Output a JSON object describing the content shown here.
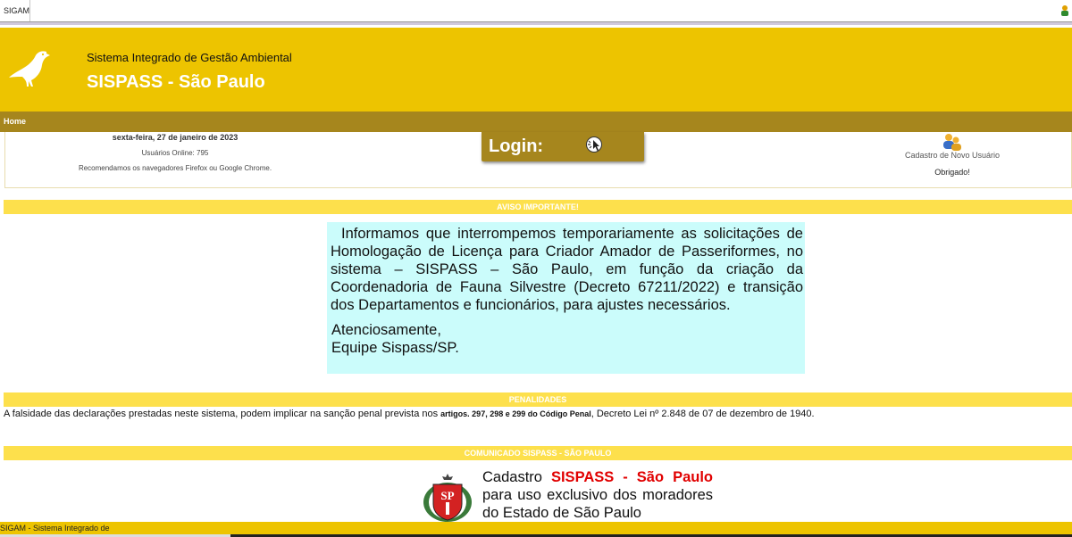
{
  "browser": {
    "tab_title": "SIGAM",
    "status_text": "SIGAM - Sistema Integrado de"
  },
  "header": {
    "subtitle": "Sistema Integrado de Gestão Ambiental",
    "title": "SISPASS - São Paulo",
    "logo_icon": "canary-bird-icon"
  },
  "nav": {
    "home": "Home"
  },
  "info": {
    "date": "sexta-feira, 27 de janeiro de 2023",
    "online": "Usuários Online: 795",
    "browsers": "Recomendamos os navegadores Firefox ou Google Chrome."
  },
  "login": {
    "label": "Login:",
    "icon": "click-cursor-icon"
  },
  "cadastro": {
    "link": "Cadastro de Novo Usuário",
    "thanks": "Obrigado!",
    "icon": "users-icon"
  },
  "aviso": {
    "heading": "AVISO IMPORTANTE!",
    "body": "Informamos que interrompemos temporariamente as solicitações de Homologação de Licença para Criador Amador de Passeriformes, no sistema – SISPASS – São Paulo, em função da criação da Coordenadoria de Fauna Silvestre (Decreto 67211/2022) e transição dos Departamentos e funcionários, para ajustes necessários.",
    "sign_1": "Atenciosamente,",
    "sign_2": "Equipe Sispass/SP."
  },
  "penalidades": {
    "heading": "PENALIDADES",
    "text_1": "A falsidade das declarações prestadas neste sistema, podem implicar na sanção penal prevista nos ",
    "text_bold": "artigos. 297, 298 e 299 do Código Penal",
    "text_2": ", Decreto Lei nº 2.848 de 07 de dezembro de 1940."
  },
  "comunicado": {
    "heading": "COMUNICADO SISPASS - SÃO PAULO",
    "text_1": "Cadastro ",
    "text_red": "SISPASS - São Paulo",
    "text_2": " para uso exclusivo dos moradores do Estado de São Paulo",
    "emblem_icon": "sao-paulo-coat-of-arms-icon"
  },
  "colors": {
    "header_yellow": "#edc400",
    "nav_olive": "#a6861d",
    "section_bar": "#fde04c",
    "notice_bg": "#cbfcfb",
    "accent_red": "#e10000"
  }
}
